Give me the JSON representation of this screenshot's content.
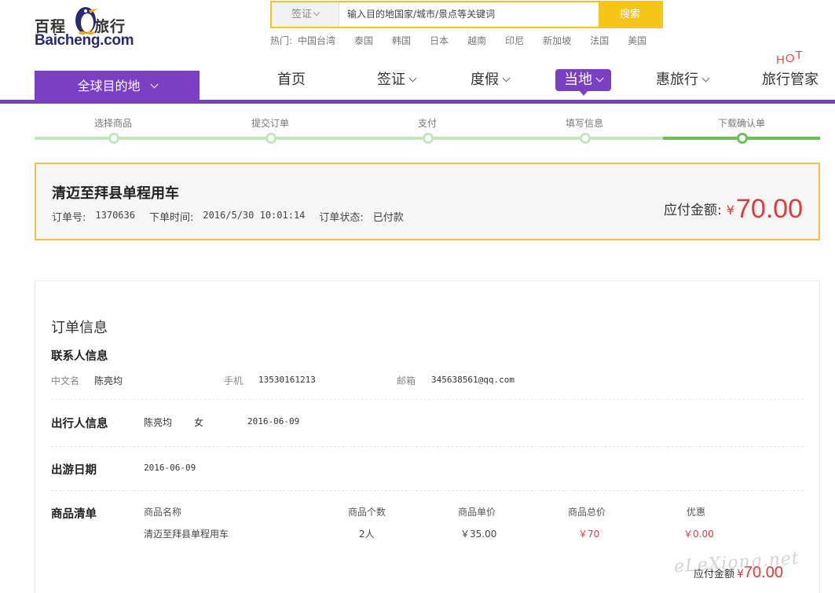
{
  "logo": {
    "cn_first": "百程",
    "cn_second": "旅行",
    "en": "Baicheng.com"
  },
  "search": {
    "type_label": "签证",
    "placeholder": "输入目的地国家/城市/景点等关键词",
    "button": "搜索"
  },
  "hot": {
    "label": "热门:",
    "links": [
      "中国台湾",
      "泰国",
      "韩国",
      "日本",
      "越南",
      "印尼",
      "新加坡",
      "法国",
      "美国"
    ]
  },
  "nav": {
    "destination": "全球目的地",
    "items": [
      "首页",
      "签证",
      "度假",
      "当地",
      "惠旅行",
      "旅行管家"
    ],
    "hot_tag": [
      "H",
      "O",
      "T"
    ]
  },
  "steps": [
    "选择商品",
    "提交订单",
    "支付",
    "填写信息",
    "下载确认单"
  ],
  "summary": {
    "title": "清迈至拜县单程用车",
    "order_no_label": "订单号:",
    "order_no": "1370636",
    "time_label": "下单时间:",
    "time": "2016/5/30 10:01:14",
    "status_label": "订单状态:",
    "status": "已付款",
    "amount_label": "应付金额:",
    "currency": "¥",
    "amount": "70.00"
  },
  "info": {
    "title": "订单信息",
    "contact": {
      "title": "联系人信息",
      "name_label": "中文名",
      "name": "陈亮均",
      "phone_label": "手机",
      "phone": "13530161213",
      "email_label": "邮箱",
      "email": "345638561@qq.com"
    },
    "traveler": {
      "title": "出行人信息",
      "name": "陈亮均",
      "gender": "女",
      "date": "2016-06-09"
    },
    "travel_date": {
      "title": "出游日期",
      "date": "2016-06-09"
    },
    "goods": {
      "title": "商品清单",
      "headers": [
        "商品名称",
        "商品个数",
        "商品单价",
        "商品总价",
        "优惠"
      ],
      "row": [
        "清迈至拜县单程用车",
        "2人",
        "￥35.00",
        "￥70",
        "￥0.00"
      ]
    },
    "total": {
      "label": "应付金额",
      "currency": "¥",
      "amount": "70.00"
    }
  },
  "watermark": "eLeXiong.net",
  "colors": {
    "brand_purple": "#7b3fc4",
    "search_yellow": "#f5c518",
    "price_red": "#e4393c",
    "step_light": "#c1e6b8",
    "step_dark": "#6dbf5a",
    "summary_border": "#f3c04e"
  }
}
